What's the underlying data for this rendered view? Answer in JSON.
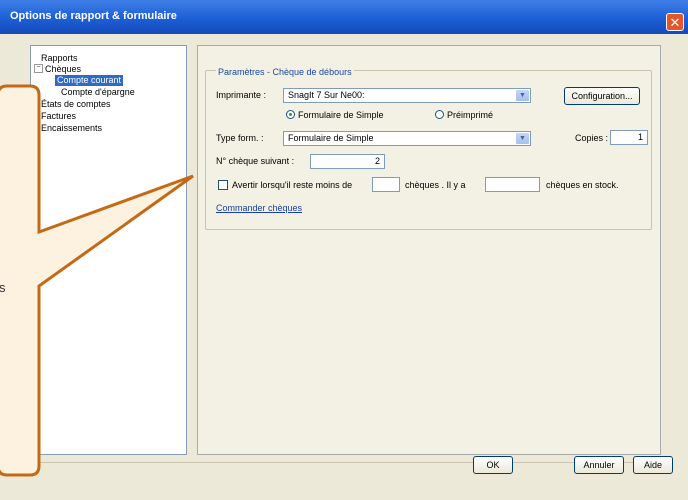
{
  "window": {
    "title": "Options de rapport & formulaire"
  },
  "tree": [
    {
      "label": "Rapports"
    },
    {
      "label": "Chèques",
      "expanded": true
    },
    {
      "label": "Compte courant",
      "selected": true
    },
    {
      "label": "Compte d'épargne"
    },
    {
      "label": "États de comptes"
    },
    {
      "label": "Factures"
    },
    {
      "label": "Encaissements"
    }
  ],
  "group": {
    "title": "Paramètres - Chèque de débours"
  },
  "printer": {
    "label": "Imprimante :",
    "value": "SnagIt 7 Sur Ne00:",
    "config_button": "Configuration..."
  },
  "radios": {
    "option1": "Formulaire de Simple",
    "option2": "Préimprimé"
  },
  "form_type": {
    "label": "Type form. :",
    "value": "Formulaire de Simple",
    "copies_label": "Copies :",
    "copies_value": "1"
  },
  "next_check": {
    "label": "N° chèque suivant :",
    "value": "2"
  },
  "warn": {
    "label": "Avertir lorsqu'il reste moins de",
    "mid": "chèques . Il y a",
    "end": "chèques en stock."
  },
  "order_link": "Commander chèques",
  "buttons": {
    "ok": "OK",
    "cancel": "Annuler",
    "help": "Aide"
  },
  "callout_fragment": "s",
  "colors": {
    "title_bar": "#1c5fd6",
    "callout_border": "#c46a16",
    "callout_fill": "#fdf1e0"
  }
}
